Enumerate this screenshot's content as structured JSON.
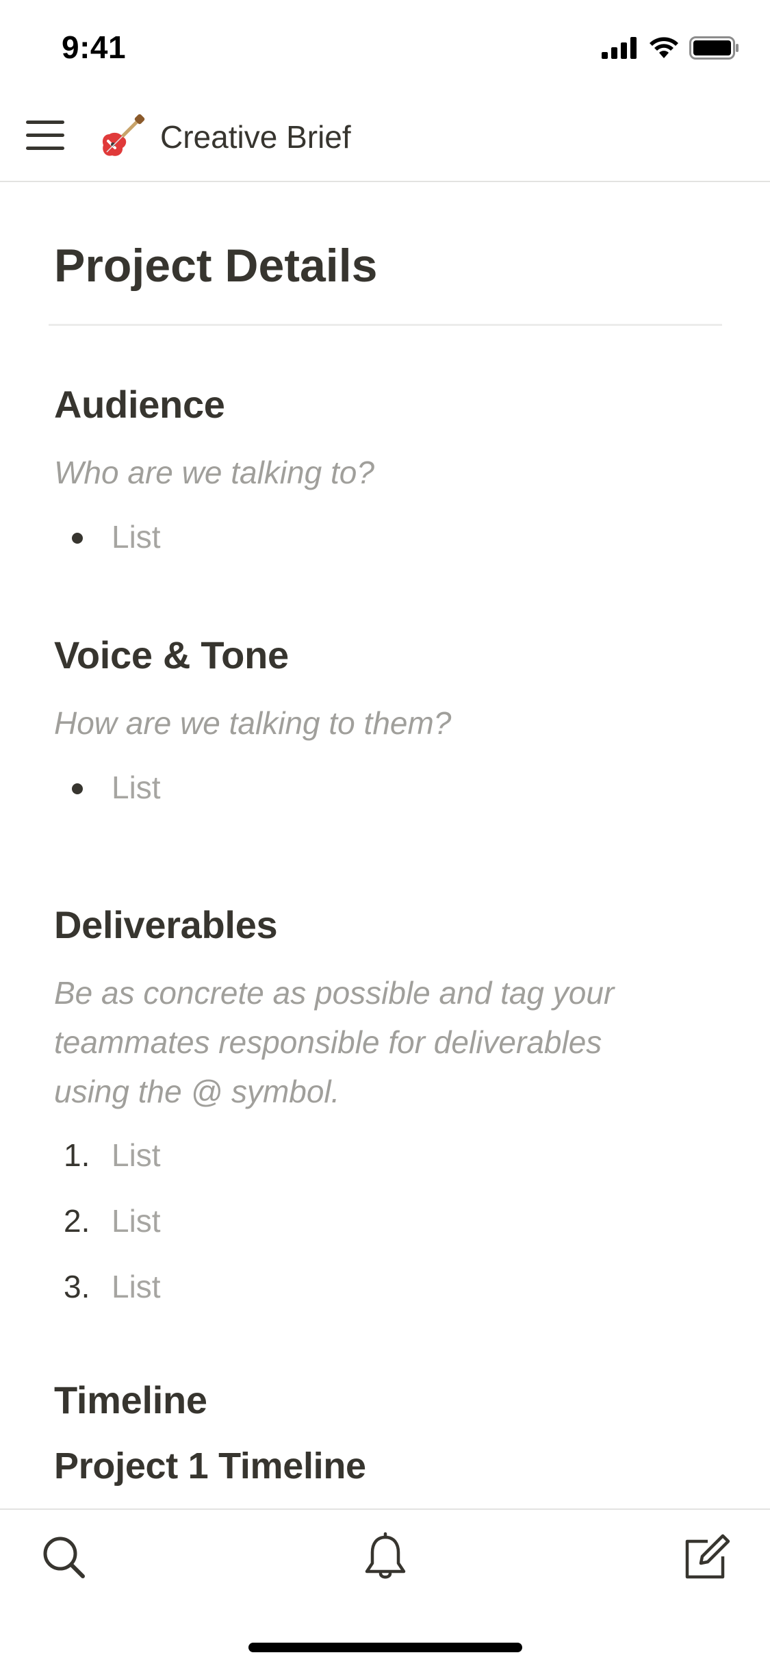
{
  "status_bar": {
    "time": "9:41"
  },
  "nav": {
    "title": "Creative Brief",
    "page_icon": "guitar-icon"
  },
  "page": {
    "title": "Project Details"
  },
  "sections": {
    "audience": {
      "heading": "Audience",
      "description": "Who are we talking to?",
      "items": [
        "List"
      ]
    },
    "voice_tone": {
      "heading": "Voice & Tone",
      "description": "How are we talking to them?",
      "items": [
        "List"
      ]
    },
    "deliverables": {
      "heading": "Deliverables",
      "description": "Be as concrete as possible and tag your teammates responsible for deliverables using the @ symbol.",
      "items": [
        {
          "marker": "1.",
          "text": "List"
        },
        {
          "marker": "2.",
          "text": "List"
        },
        {
          "marker": "3.",
          "text": "List"
        }
      ]
    },
    "timeline": {
      "heading": "Timeline",
      "subheading": "Project 1 Timeline"
    }
  },
  "tab_bar": {
    "icons": [
      "search-icon",
      "bell-icon",
      "compose-icon"
    ]
  },
  "colors": {
    "text": "#37352f",
    "placeholder": "#a6a5a1",
    "divider": "#e3e3e1"
  }
}
